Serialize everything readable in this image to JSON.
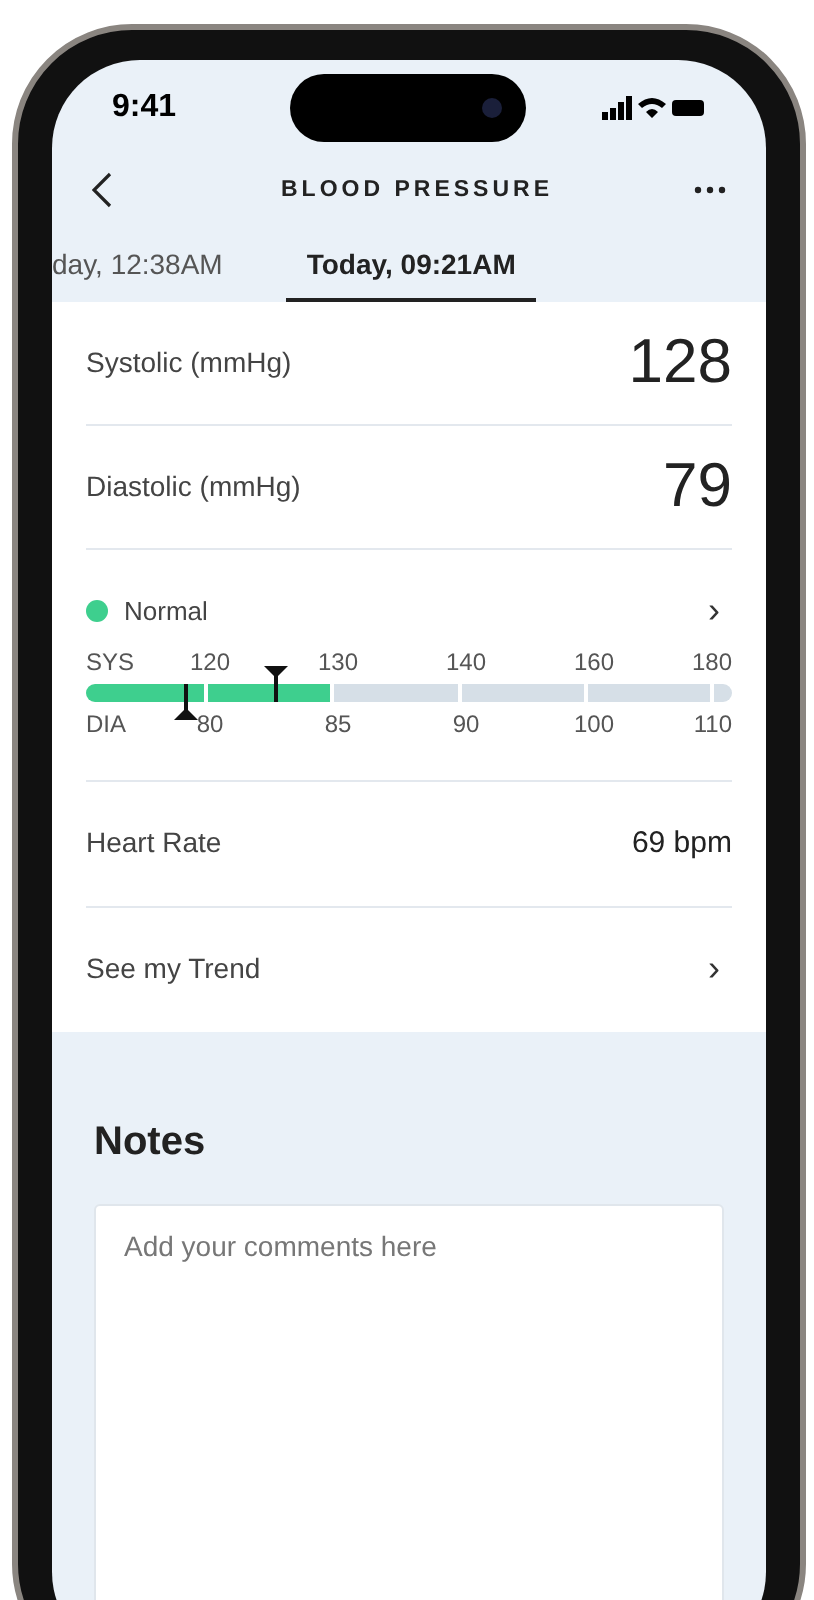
{
  "status_bar": {
    "time": "9:41"
  },
  "nav": {
    "title": "BLOOD PRESSURE"
  },
  "tabs": [
    {
      "label": "day, 12:38AM",
      "selected": false
    },
    {
      "label": "Today, 09:21AM",
      "selected": true
    }
  ],
  "readings": [
    {
      "label": "Systolic (mmHg)",
      "value": "128"
    },
    {
      "label": "Diastolic (mmHg)",
      "value": "79"
    }
  ],
  "status": {
    "label": "Normal",
    "color": "#3ecf8e",
    "chevron": "›"
  },
  "gauge": {
    "sys_label": "SYS",
    "dia_label": "DIA",
    "sys_ticks": [
      "120",
      "130",
      "140",
      "160",
      "180"
    ],
    "dia_ticks": [
      "80",
      "85",
      "90",
      "100",
      "110"
    ],
    "segments": [
      {
        "filled": true
      },
      {
        "filled": true
      },
      {
        "filled": false
      },
      {
        "filled": false
      },
      {
        "filled": false
      },
      {
        "filled": false
      }
    ],
    "sys_marker": {
      "level": 0.295
    },
    "dia_marker": {
      "level": 0.155
    }
  },
  "heart_rate": {
    "label": "Heart Rate",
    "value": "69 bpm"
  },
  "trend": {
    "label": "See my Trend",
    "chevron": "›"
  },
  "notes": {
    "title": "Notes",
    "placeholder": "Add your comments here"
  }
}
